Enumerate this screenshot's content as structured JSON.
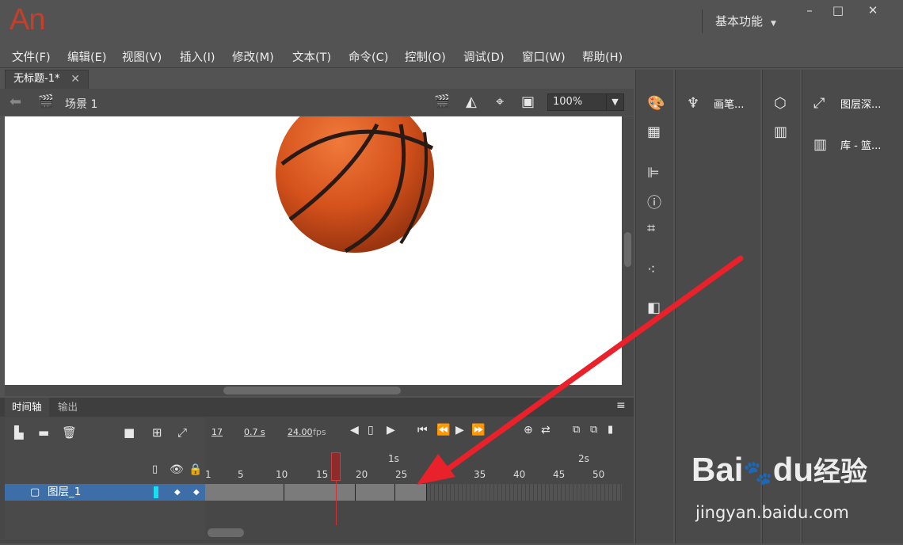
{
  "app": {
    "logo": "An",
    "workspace": "基本功能",
    "win_min": "–",
    "win_max": "□",
    "win_close": "✕"
  },
  "menu": [
    "文件(F)",
    "编辑(E)",
    "视图(V)",
    "插入(I)",
    "修改(M)",
    "文本(T)",
    "命令(C)",
    "控制(O)",
    "调试(D)",
    "窗口(W)",
    "帮助(H)"
  ],
  "document": {
    "tab": "无标题-1*",
    "close": "✕",
    "scene": "场景 1",
    "zoom": "100%"
  },
  "timeline": {
    "tabs": [
      "时间轴",
      "输出"
    ],
    "frame": "17",
    "seconds": "0.7 s",
    "fps": "24.00",
    "fps_unit": "fps",
    "ruler_ticks": [
      "1",
      "5",
      "10",
      "15",
      "20",
      "25",
      "30",
      "35",
      "40",
      "45",
      "50"
    ],
    "seconds_marks": [
      "1s",
      "2s"
    ],
    "layer_name": "图层_1",
    "playhead_frame": 17,
    "keyframe_segments": [
      [
        1,
        10
      ],
      [
        11,
        19
      ],
      [
        20,
        24
      ],
      [
        25,
        28
      ]
    ]
  },
  "panels": {
    "brushes": "画笔...",
    "layer_depth": "图层深...",
    "library": "库 - 篮..."
  },
  "watermark": {
    "brand": "Bai",
    "brand2": "du",
    "cn": "经验",
    "url": "jingyan.baidu.com"
  },
  "colors": {
    "accent_arrow": "#e8212a",
    "selected_layer": "#3e6ea8",
    "logo": "#c4402a"
  }
}
